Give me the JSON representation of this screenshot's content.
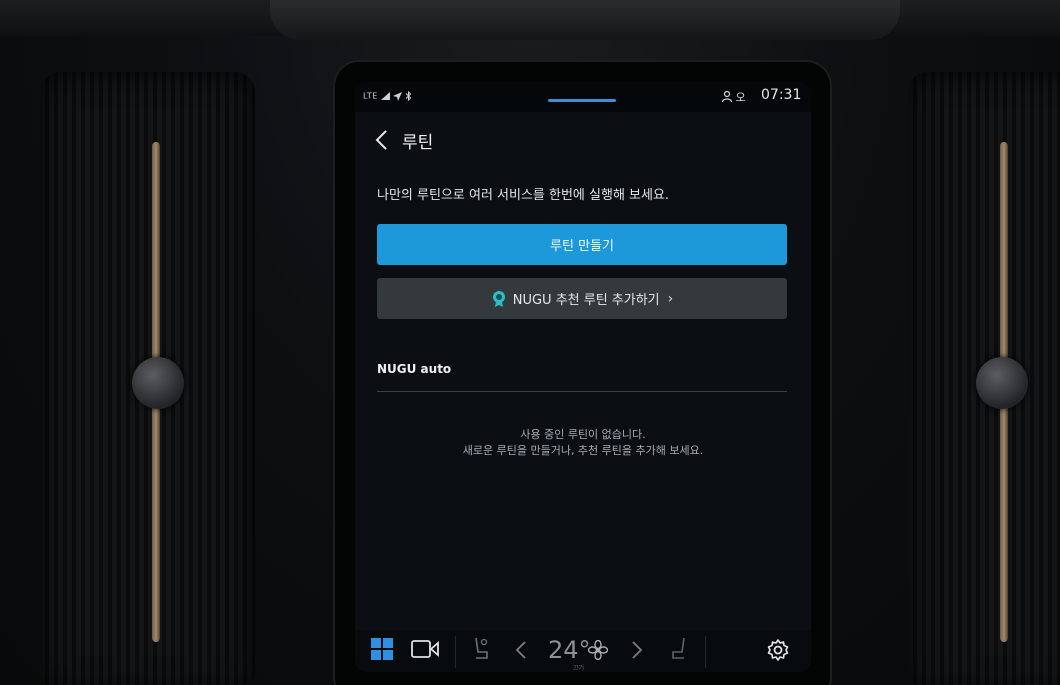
{
  "status_bar": {
    "network": "LTE",
    "user_label": "오",
    "time": "07:31"
  },
  "header": {
    "title": "루틴"
  },
  "intro_text": "나만의 루틴으로 여러 서비스를 한번에 실행해 보세요.",
  "buttons": {
    "create_routine": "루틴 만들기",
    "add_recommended": "NUGU 추천 루틴 추가하기"
  },
  "section": {
    "title": "NUGU auto",
    "empty_line1": "사용 중인 루틴이 없습니다.",
    "empty_line2": "새로운 루틴을 만들거나, 추천 루틴을 추가해 보세요."
  },
  "climate": {
    "temperature": "24°",
    "fan_label": "끄기"
  },
  "icons": {
    "back": "back-chevron-icon",
    "badge": "award-badge-icon",
    "apps": "app-grid-icon",
    "camera": "camera-icon",
    "seat_left": "seat-heat-left-icon",
    "seat_right": "seat-heat-right-icon",
    "fan": "fan-icon",
    "settings": "gear-icon"
  },
  "colors": {
    "accent": "#1d98d8",
    "background": "#0b0f14",
    "secondary_button": "#34393e"
  }
}
